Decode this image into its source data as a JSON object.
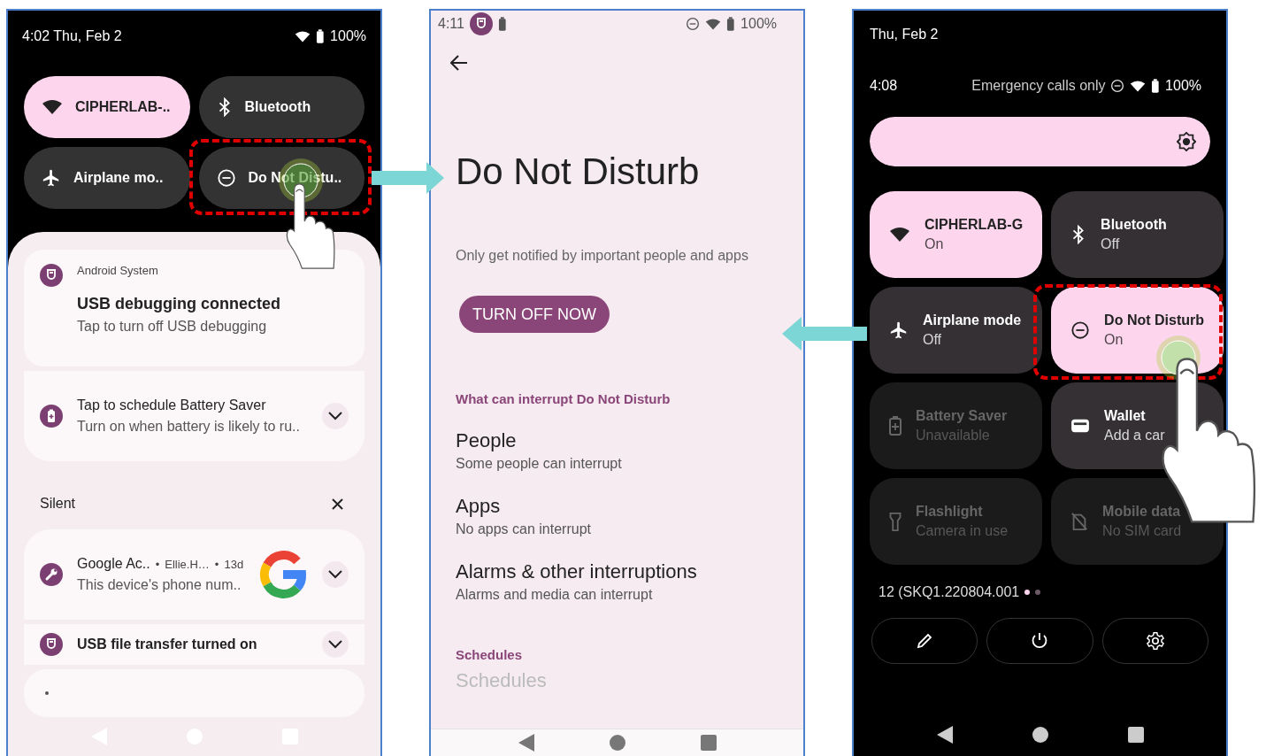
{
  "left_panel": {
    "status_bar": {
      "time_date": "4:02 Thu, Feb 2",
      "battery": "100%"
    },
    "tiles": [
      {
        "kind": "wifi",
        "label": "CIPHERLAB-..",
        "on": true
      },
      {
        "kind": "bluetooth",
        "label": "Bluetooth",
        "on": false
      },
      {
        "kind": "airplane",
        "label": "Airplane mo..",
        "on": false
      },
      {
        "kind": "dnd",
        "label": "Do Not Distu..",
        "on": false
      }
    ],
    "notifications": [
      {
        "kind": "usb",
        "app": "Android System",
        "title": "USB debugging connected",
        "text": "Tap to turn off USB debugging"
      },
      {
        "kind": "battery",
        "title": "Tap to schedule Battery Saver",
        "text": "Turn on when battery is likely to ru.."
      }
    ],
    "silent_section": {
      "label": "Silent"
    },
    "silent_notifications": [
      {
        "kind": "wrench",
        "title": "Google Ac..",
        "separators": [
          "•",
          "•"
        ],
        "app": "Ellie.H…",
        "time": "13d",
        "text": "This device's phone num.."
      },
      {
        "kind": "usb",
        "title": "USB file transfer turned on"
      }
    ]
  },
  "middle_panel": {
    "status_bar": {
      "time": "4:11",
      "battery": "100%"
    },
    "title": "Do Not Disturb",
    "description": "Only get notified by important people and apps",
    "button": {
      "label": "TURN OFF NOW"
    },
    "sections": [
      {
        "header": "What can interrupt Do Not Disturb",
        "items": [
          {
            "title": "People",
            "summary": "Some people can interrupt"
          },
          {
            "title": "Apps",
            "summary": "No apps can interrupt"
          },
          {
            "title": "Alarms & other interruptions",
            "summary": "Alarms and media can interrupt"
          }
        ]
      },
      {
        "header": "Schedules",
        "items": [
          {
            "title": "Schedules"
          }
        ]
      }
    ]
  },
  "right_panel": {
    "date": "Thu, Feb 2",
    "time": "4:08",
    "carrier": "Emergency calls only",
    "battery": "100%",
    "brightness": {
      "level": 1
    },
    "tiles": [
      {
        "kind": "wifi",
        "label": "CIPHERLAB-G",
        "on": true,
        "disabled": false,
        "secondary": "On"
      },
      {
        "kind": "bluetooth",
        "label": "Bluetooth",
        "on": false,
        "disabled": false,
        "secondary": "Off"
      },
      {
        "kind": "airplane",
        "label": "Airplane mode",
        "on": false,
        "disabled": false,
        "secondary": "Off"
      },
      {
        "kind": "dnd",
        "label": "Do Not Disturb",
        "on": true,
        "disabled": false,
        "secondary": "On"
      },
      {
        "kind": "battery",
        "label": "Battery Saver",
        "disabled": true,
        "secondary": "Unavailable"
      },
      {
        "kind": "wallet",
        "label": "Wallet",
        "on": false,
        "disabled": false,
        "secondary": "Add a car"
      },
      {
        "kind": "flashlight",
        "label": "Flashlight",
        "disabled": true,
        "secondary": "Camera in use"
      },
      {
        "kind": "sim",
        "label": "Mobile data",
        "disabled": true,
        "secondary": "No SIM card"
      }
    ],
    "build": "12 (SKQ1.220804.001",
    "pages": [
      {
        "selected": true
      },
      {
        "selected": false
      }
    ]
  }
}
